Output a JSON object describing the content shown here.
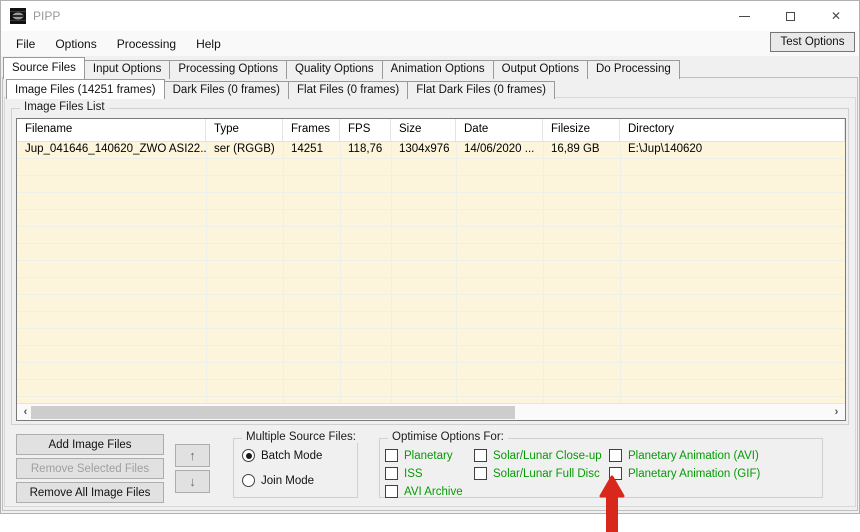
{
  "window": {
    "title": "PIPP",
    "controls": {
      "minimize": "minimize",
      "maximize": "maximize",
      "close": "✕"
    }
  },
  "menu": {
    "items": [
      "File",
      "Options",
      "Processing",
      "Help"
    ],
    "test_options_label": "Test Options"
  },
  "tabs_main": {
    "selected": "Source Files",
    "items": [
      "Source Files",
      "Input Options",
      "Processing Options",
      "Quality Options",
      "Animation Options",
      "Output Options",
      "Do Processing"
    ]
  },
  "tabs_files": {
    "selected": "Image Files (14251 frames)",
    "items": [
      "Image Files (14251 frames)",
      "Dark Files (0 frames)",
      "Flat Files (0 frames)",
      "Flat Dark Files (0 frames)"
    ]
  },
  "image_files_list": {
    "group_label": "Image Files List",
    "columns": [
      "Filename",
      "Type",
      "Frames",
      "FPS",
      "Size",
      "Date",
      "Filesize",
      "Directory"
    ],
    "rows": [
      [
        "Jup_041646_140620_ZWO ASI22...",
        "ser (RGGB)",
        "14251",
        "118,76",
        "1304x976",
        "14/06/2020 ...",
        "16,89 GB",
        "E:\\Jup\\140620"
      ]
    ],
    "scrollbar": {
      "left_arrow": "‹",
      "right_arrow": "›"
    }
  },
  "file_buttons": {
    "add": "Add Image Files",
    "remove_selected": "Remove Selected Files",
    "remove_all": "Remove All Image Files",
    "move_up": "↑",
    "move_down": "↓"
  },
  "multiple_source_files": {
    "label": "Multiple Source Files:",
    "options": [
      {
        "label": "Batch Mode",
        "selected": true
      },
      {
        "label": "Join Mode",
        "selected": false
      }
    ]
  },
  "optimise_options": {
    "label": "Optimise Options For:",
    "columns": [
      {
        "items": [
          {
            "label": "Planetary",
            "checked": false
          },
          {
            "label": "ISS",
            "checked": false
          },
          {
            "label": "AVI Archive",
            "checked": false
          }
        ]
      },
      {
        "items": [
          {
            "label": "Solar/Lunar Close-up",
            "checked": false
          },
          {
            "label": "Solar/Lunar Full Disc",
            "checked": false
          }
        ]
      },
      {
        "items": [
          {
            "label": "Planetary Animation (AVI)",
            "checked": false
          },
          {
            "label": "Planetary Animation (GIF)",
            "checked": false
          }
        ]
      }
    ]
  },
  "annotation": {
    "type": "red-arrow-up",
    "points_at": "Planetary Animation (GIF) checkbox",
    "color": "#d8281c"
  },
  "colors": {
    "list_background": "#fcf5db",
    "option_label_green": "#069a06",
    "form_background": "#f0f0f0"
  }
}
